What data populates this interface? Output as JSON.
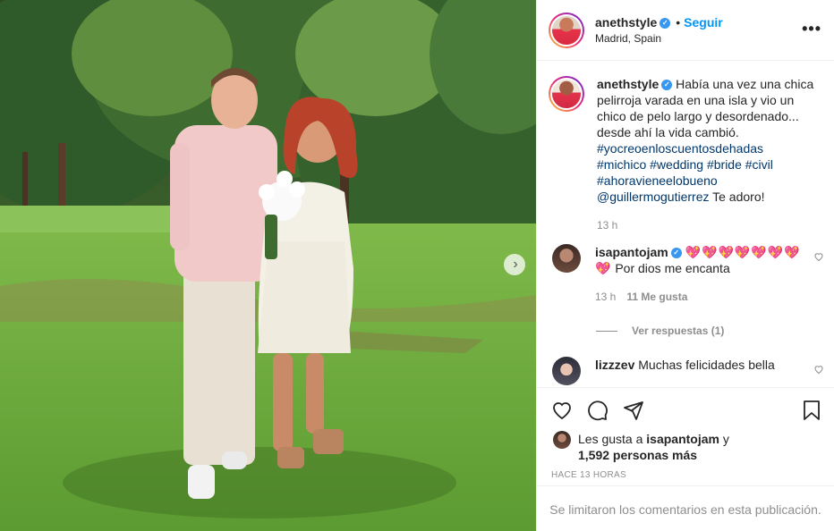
{
  "post": {
    "username": "anethstyle",
    "follow_label": "Seguir",
    "location": "Madrid, Spain",
    "more_label": "•••"
  },
  "caption": {
    "username": "anethstyle",
    "text": "Había una vez una chica pelirroja varada en una isla y vio un chico de pelo largo y desordenado... desde ahí la vida cambió.",
    "tags_line1": "#yocreoenloscuentosdehadas",
    "tags_line2": "#michico #wedding #bride #civil",
    "tags_line3": "#ahoravieneelobueno",
    "mention": "@guillermogutierrez",
    "mention_suffix": " Te adoro!",
    "time": "13 h"
  },
  "comments": [
    {
      "username": "isapantojam",
      "hearts": "💖💖💖💖💖💖💖💖",
      "text": "Por dios me encanta",
      "time": "13 h",
      "likes": "11 Me gusta",
      "replies": "Ver respuestas (1)"
    },
    {
      "username": "lizzzev",
      "text": "Muchas felicidades bella"
    }
  ],
  "likes": {
    "prefix": "Les gusta a ",
    "user": "isapantojam",
    "suffix": " y",
    "count": "1,592 personas más"
  },
  "posted_time": "HACE 13 HORAS",
  "comments_limited": "Se limitaron los comentarios en esta publicación.",
  "colors": {
    "accent": "#0095f6",
    "verified": "#3897f0",
    "hashtag": "#00376b"
  }
}
